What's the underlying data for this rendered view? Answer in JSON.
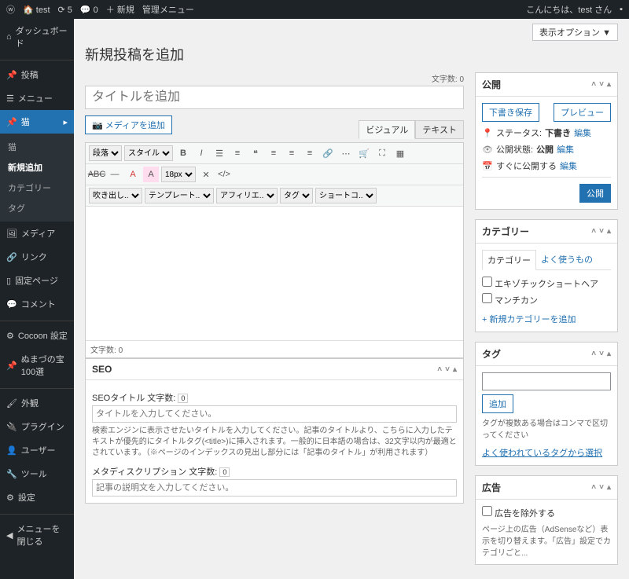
{
  "adminbar": {
    "site": "test",
    "comments": "0",
    "updates": "5",
    "new": "＋ 新規",
    "manage": "管理メニュー",
    "greeting": "こんにちは、test さん"
  },
  "sidebar": {
    "dashboard": "ダッシュボード",
    "posts": "投稿",
    "menu": "メニュー",
    "cat": "猫",
    "sub_all": "猫",
    "sub_new": "新規追加",
    "sub_cat": "カテゴリー",
    "sub_tag": "タグ",
    "media": "メディア",
    "links": "リンク",
    "pages": "固定ページ",
    "comments": "コメント",
    "cocoon": "Cocoon 設定",
    "numazu": "ぬまづの宝100選",
    "appearance": "外観",
    "plugins": "プラグイン",
    "users": "ユーザー",
    "tools": "ツール",
    "settings": "設定",
    "collapse": "メニューを閉じる"
  },
  "page": {
    "screen_options": "表示オプション ▼",
    "heading": "新規投稿を追加",
    "title_ph": "タイトルを追加",
    "charcount_label": "文字数:",
    "charcount_val": "0",
    "add_media": "メディアを追加",
    "tab_visual": "ビジュアル",
    "tab_text": "テキスト"
  },
  "toolbar": {
    "paragraph": "段落",
    "style": "スタイル",
    "fontsize": "18px",
    "吹き出し": "吹き出し..",
    "template": "テンプレート..",
    "affiliate": "アフィリエ..",
    "tag": "タグ",
    "shortcode": "ショートコ.."
  },
  "seo": {
    "box_title": "SEO",
    "title_label": "SEOタイトル",
    "title_ph": "タイトルを入力してください。",
    "title_desc": "検索エンジンに表示させたいタイトルを入力してください。記事のタイトルより、こちらに入力したテキストが優先的にタイトルタグ(<title>)に挿入されます。一般的に日本語の場合は、32文字以内が最適とされています。（※ページのインデックスの見出し部分には「記事のタイトル」が利用されます）",
    "meta_label": "メタディスクリプション",
    "meta_ph": "記事の説明文を入力してください。"
  },
  "publish": {
    "title": "公開",
    "save_draft": "下書き保存",
    "preview": "プレビュー",
    "status_label": "ステータス:",
    "status_val": "下書き",
    "visibility_label": "公開状態:",
    "visibility_val": "公開",
    "schedule_label": "すぐに公開する",
    "edit": "編集",
    "submit": "公開"
  },
  "categories": {
    "title": "カテゴリー",
    "tab_all": "カテゴリー",
    "tab_popular": "よく使うもの",
    "items": [
      "エキゾチックショートヘア",
      "マンチカン"
    ],
    "add_new": "+ 新規カテゴリーを追加"
  },
  "tags": {
    "title": "タグ",
    "add": "追加",
    "help": "タグが複数ある場合はコンマで区切ってください",
    "popular": "よく使われているタグから選択"
  },
  "ads": {
    "title": "広告",
    "exclude": "広告を除外する",
    "desc": "ページ上の広告（AdSenseなど）表示を切り替えます。「広告」設定でカテゴリごと..."
  }
}
